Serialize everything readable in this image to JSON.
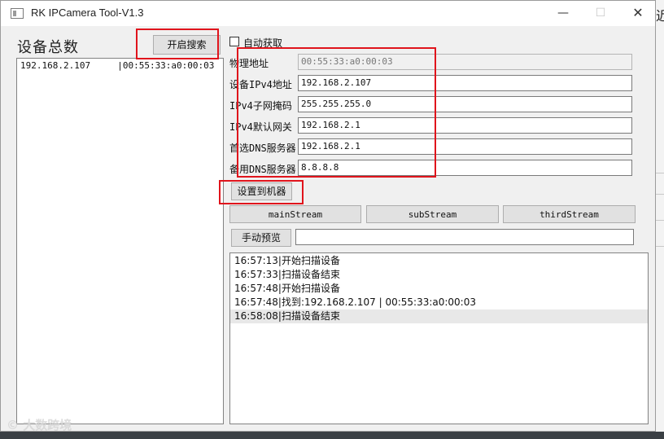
{
  "background": {
    "right_text": "近"
  },
  "window": {
    "title": "RK IPCamera Tool-V1.3",
    "controls": {
      "minimize": "—",
      "maximize": "☐",
      "close": "✕"
    }
  },
  "left": {
    "title": "设备总数",
    "search_button": "开启搜索",
    "devices": [
      {
        "text": "192.168.2.107     |00:55:33:a0:00:03"
      }
    ]
  },
  "auto_fetch": {
    "label": "自动获取",
    "checked": false
  },
  "fields": [
    {
      "label": "物理地址",
      "value": "00:55:33:a0:00:03",
      "readonly": true
    },
    {
      "label": "设备IPv4地址",
      "value": "192.168.2.107"
    },
    {
      "label": "IPv4子网掩码",
      "value": "255.255.255.0"
    },
    {
      "label": "IPv4默认网关",
      "value": "192.168.2.1"
    },
    {
      "label": "首选DNS服务器",
      "value": "192.168.2.1"
    },
    {
      "label": "备用DNS服务器",
      "value": "8.8.8.8"
    }
  ],
  "buttons": {
    "set_to_device": "设置到机器",
    "main_stream": "mainStream",
    "sub_stream": "subStream",
    "third_stream": "thirdStream",
    "manual_preview": "手动预览"
  },
  "preview_url": "",
  "log": [
    "16:57:13|开始扫描设备",
    "16:57:33|扫描设备结束",
    "16:57:48|开始扫描设备",
    "16:57:48|找到:192.168.2.107 | 00:55:33:a0:00:03",
    "16:58:08|扫描设备结束"
  ],
  "log_selected_index": 4,
  "watermark": "© 大数跨境",
  "colors": {
    "highlight": "#e0141c",
    "selection": "#e8e8e8"
  }
}
